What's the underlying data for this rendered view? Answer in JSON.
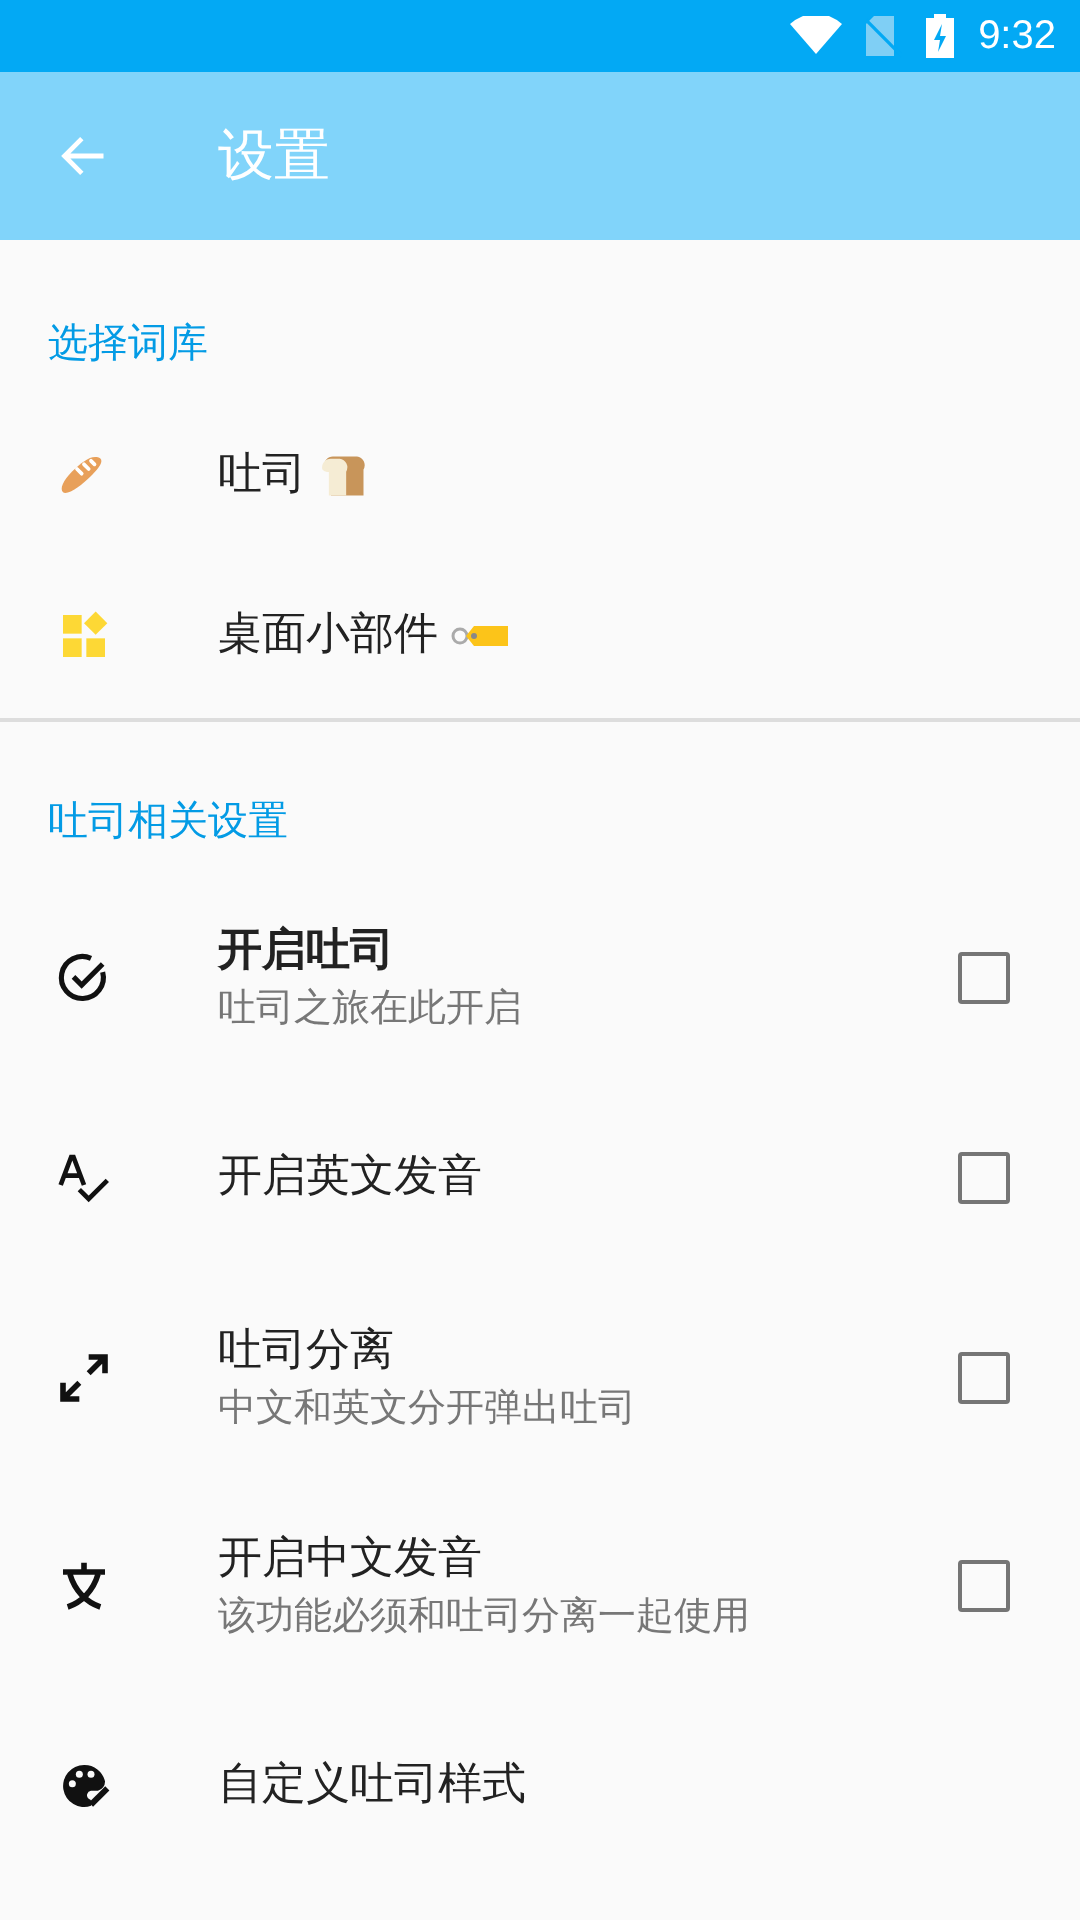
{
  "status_bar": {
    "time": "9:32"
  },
  "app_bar": {
    "title": "设置"
  },
  "sections": [
    {
      "header": "选择词库",
      "items": [
        {
          "kind": "link",
          "title": "吐司"
        },
        {
          "kind": "link",
          "title": "桌面小部件"
        }
      ]
    },
    {
      "header": "吐司相关设置",
      "items": [
        {
          "kind": "checkbox",
          "title": "开启吐司",
          "bold": true,
          "subtitle": "吐司之旅在此开启",
          "checked": false
        },
        {
          "kind": "checkbox",
          "title": "开启英文发音",
          "bold": false,
          "checked": false
        },
        {
          "kind": "checkbox",
          "title": "吐司分离",
          "bold": false,
          "subtitle": "中文和英文分开弹出吐司",
          "checked": false
        },
        {
          "kind": "checkbox",
          "title": "开启中文发音",
          "bold": false,
          "subtitle": "该功能必须和吐司分离一起使用",
          "checked": false
        },
        {
          "kind": "link",
          "title": "自定义吐司样式"
        }
      ]
    }
  ]
}
